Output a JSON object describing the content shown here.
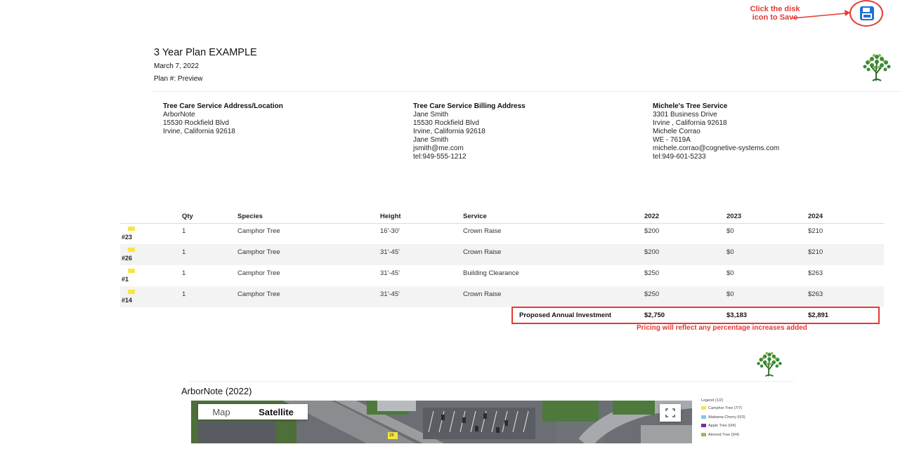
{
  "callout": {
    "line1": "Click the disk",
    "line2": "icon to Save"
  },
  "plan": {
    "title": "3 Year Plan EXAMPLE",
    "date": "March 7, 2022",
    "plan_number": "Plan #: Preview"
  },
  "addresses": [
    {
      "heading": "Tree Care Service Address/Location",
      "lines": [
        "ArborNote",
        "15530 Rockfield Blvd",
        "Irvine, California 92618"
      ]
    },
    {
      "heading": "Tree Care Service Billing Address",
      "lines": [
        "Jane Smith",
        "15530 Rockfield Blvd",
        "Irvine, California 92618",
        "Jane Smith",
        "jsmith@me.com",
        "tel:949-555-1212"
      ]
    },
    {
      "heading": "Michele's Tree Service",
      "lines": [
        "3301 Business Drive",
        "Irvine , California 92618",
        "Michele Corrao",
        "WE - 7619A",
        "michele.corrao@cognetive-systems.com",
        "tel:949-601-5233"
      ]
    }
  ],
  "table": {
    "headers": {
      "qty": "Qty",
      "species": "Species",
      "height": "Height",
      "service": "Service",
      "y1": "2022",
      "y2": "2023",
      "y3": "2024"
    },
    "tag_color": "#f5e642",
    "rows": [
      {
        "tag": "#23",
        "qty": "1",
        "species": "Camphor Tree",
        "height": "16'-30'",
        "service": "Crown Raise",
        "y1": "$200",
        "y2": "$0",
        "y3": "$210"
      },
      {
        "tag": "#26",
        "qty": "1",
        "species": "Camphor Tree",
        "height": "31'-45'",
        "service": "Crown Raise",
        "y1": "$200",
        "y2": "$0",
        "y3": "$210"
      },
      {
        "tag": "#1",
        "qty": "1",
        "species": "Camphor Tree",
        "height": "31'-45'",
        "service": "Building Clearance",
        "y1": "$250",
        "y2": "$0",
        "y3": "$263"
      },
      {
        "tag": "#14",
        "qty": "1",
        "species": "Camphor Tree",
        "height": "31'-45'",
        "service": "Crown Raise",
        "y1": "$250",
        "y2": "$0",
        "y3": "$263"
      }
    ],
    "investment": {
      "label": "Proposed Annual Investment",
      "y1": "$2,750",
      "y2": "$3,183",
      "y3": "$2,891"
    },
    "pricing_note": "Pricing will reflect any percentage increases added"
  },
  "map": {
    "title": "ArborNote (2022)",
    "tabs": [
      "Map",
      "Satellite"
    ],
    "selected_tab": "Satellite",
    "marker_label": "26",
    "legend_title": "Legend (1/2)",
    "legend": [
      {
        "label": "Camphor Tree (7/7)",
        "color": "#f5e642"
      },
      {
        "label": "Alabama Cherry (0/3)",
        "color": "#7fc9e0"
      },
      {
        "label": "Apple Tree (0/4)",
        "color": "#7b2ea0"
      },
      {
        "label": "Almond Tree (0/4)",
        "color": "#8bc34a"
      }
    ]
  },
  "colors": {
    "accent": "#e53935",
    "save_icon": "#1e6fd9",
    "tree_logo": "#3a8a3a"
  }
}
